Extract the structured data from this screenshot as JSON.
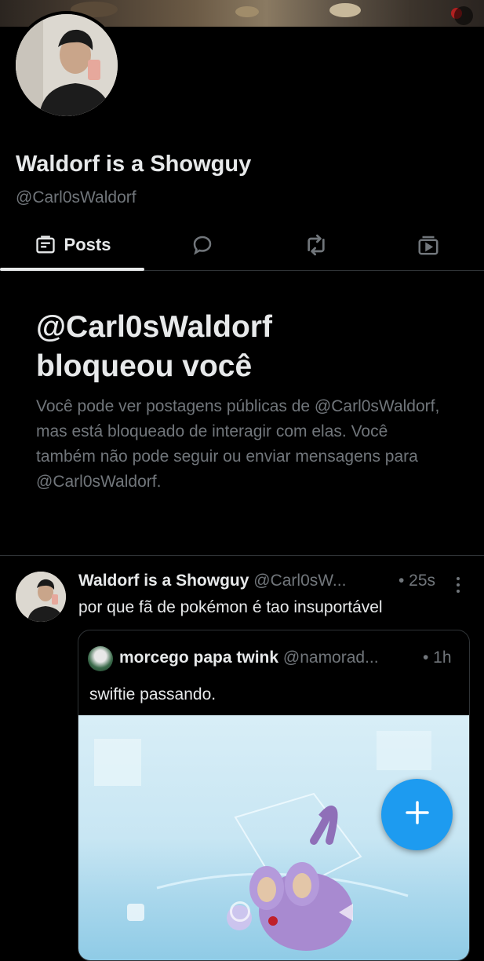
{
  "profile": {
    "display_name": "Waldorf is a Showguy",
    "handle": "@Carl0sWaldorf"
  },
  "tabs": [
    {
      "label": "Posts",
      "icon": "posts-icon",
      "active": true
    },
    {
      "label": "",
      "icon": "replies-icon",
      "active": false
    },
    {
      "label": "",
      "icon": "repost-icon",
      "active": false
    },
    {
      "label": "",
      "icon": "media-icon",
      "active": false
    }
  ],
  "blocked_notice": {
    "title_line1": "@Carl0sWaldorf",
    "title_line2": "bloqueou você",
    "message": "Você pode ver postagens públicas de @Carl0sWaldorf, mas está bloqueado de interagir com elas. Você também não pode seguir ou enviar mensagens para @Carl0sWaldorf."
  },
  "post": {
    "author_name": "Waldorf is a Showguy",
    "author_handle": "@Carl0sW...",
    "time": "• 25s",
    "text": "por que fã de pokémon é tao insuportável",
    "quote": {
      "author_name": "morcego papa twink",
      "author_handle": "@namorad...",
      "time": "• 1h",
      "text": "swiftie passando."
    }
  },
  "colors": {
    "background": "#000000",
    "primary_text": "#e7e9ea",
    "secondary_text": "#71767b",
    "accent": "#1d9bf0",
    "divider": "#2f3336"
  }
}
